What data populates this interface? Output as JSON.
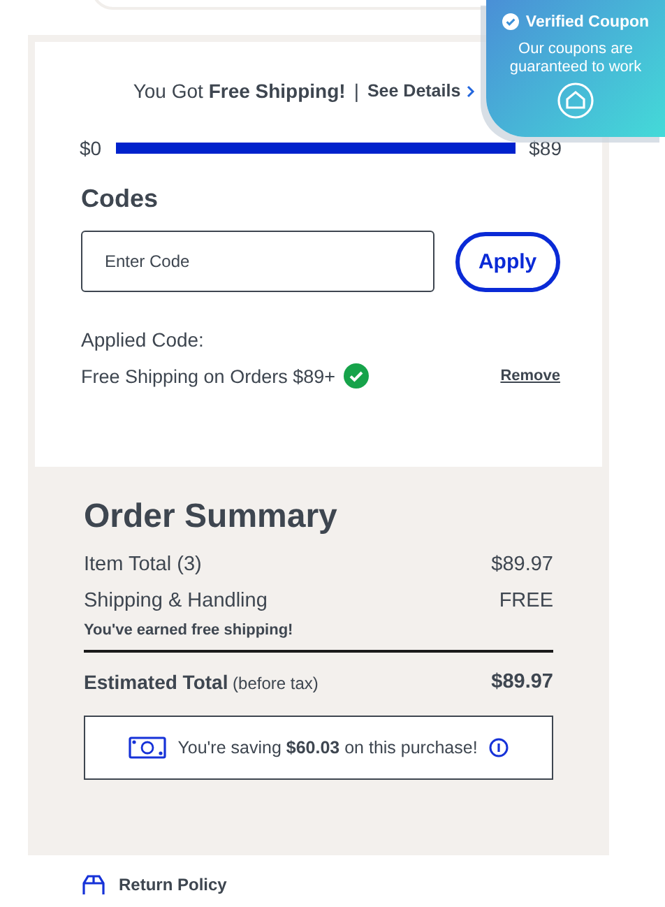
{
  "shipping_banner": {
    "text": "You Got **Free Shipping!**",
    "separator": "|",
    "link": "See Details"
  },
  "progress": {
    "start": "$0",
    "end": "$89",
    "level": 1
  },
  "codes": {
    "title": "Codes",
    "field": {
      "placeholder": "Enter Code"
    },
    "button": "Apply",
    "applied_label": "Applied Code:",
    "applied_code": "Free Shipping on Orders $89+",
    "remove": "Remove"
  },
  "summary": {
    "title": "Order Summary",
    "rows": [
      {
        "label": "Item Total (3)",
        "value": "$89.97"
      },
      {
        "label": "Shipping & Handling",
        "value": "FREE"
      }
    ],
    "note": "You've earned free shipping!",
    "total": {
      "label": "**Estimated Total** (before tax)",
      "value": "$89.97"
    },
    "savings": "You're saving **$60.03** on this purchase!"
  },
  "return_policy": "Return Policy",
  "verified_coupon": {
    "title": "Verified Coupon",
    "text": "Our coupons are guaranteed to work"
  }
}
